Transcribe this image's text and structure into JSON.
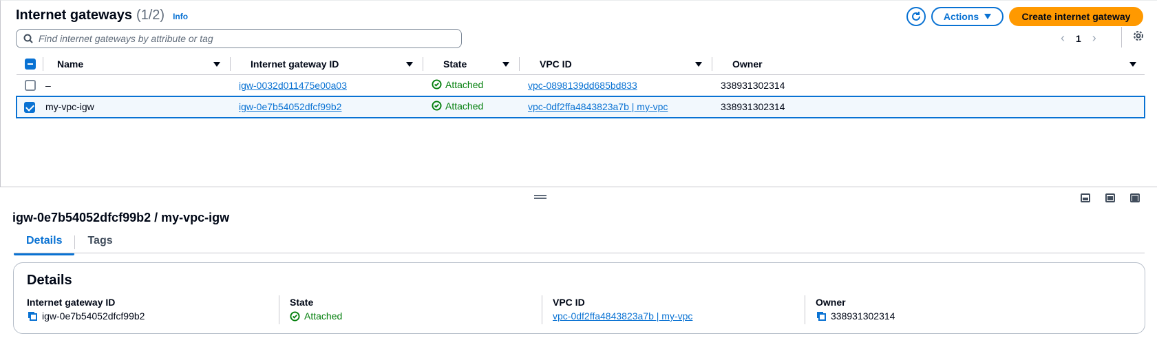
{
  "header": {
    "title": "Internet gateways",
    "count": "(1/2)",
    "info": "Info",
    "actions_label": "Actions",
    "create_label": "Create internet gateway"
  },
  "search": {
    "placeholder": "Find internet gateways by attribute or tag"
  },
  "pagination": {
    "page": "1"
  },
  "table": {
    "columns": [
      "Name",
      "Internet gateway ID",
      "State",
      "VPC ID",
      "Owner"
    ],
    "rows": [
      {
        "selected": false,
        "name": "–",
        "igw_id": "igw-0032d011475e00a03",
        "state": "Attached",
        "vpc_id": "vpc-0898139dd685bd833",
        "owner": "338931302314"
      },
      {
        "selected": true,
        "name": "my-vpc-igw",
        "igw_id": "igw-0e7b54052dfcf99b2",
        "state": "Attached",
        "vpc_id": "vpc-0df2ffa4843823a7b | my-vpc",
        "owner": "338931302314"
      }
    ]
  },
  "detail": {
    "title": "igw-0e7b54052dfcf99b2 / my-vpc-igw",
    "tabs": [
      "Details",
      "Tags"
    ],
    "section_title": "Details",
    "fields": {
      "igw_id_label": "Internet gateway ID",
      "igw_id_value": "igw-0e7b54052dfcf99b2",
      "state_label": "State",
      "state_value": "Attached",
      "vpc_label": "VPC ID",
      "vpc_value": "vpc-0df2ffa4843823a7b | my-vpc",
      "owner_label": "Owner",
      "owner_value": "338931302314"
    }
  },
  "colors": {
    "link": "#0972d3",
    "success": "#037f0c",
    "primary_button": "#ff9900"
  }
}
